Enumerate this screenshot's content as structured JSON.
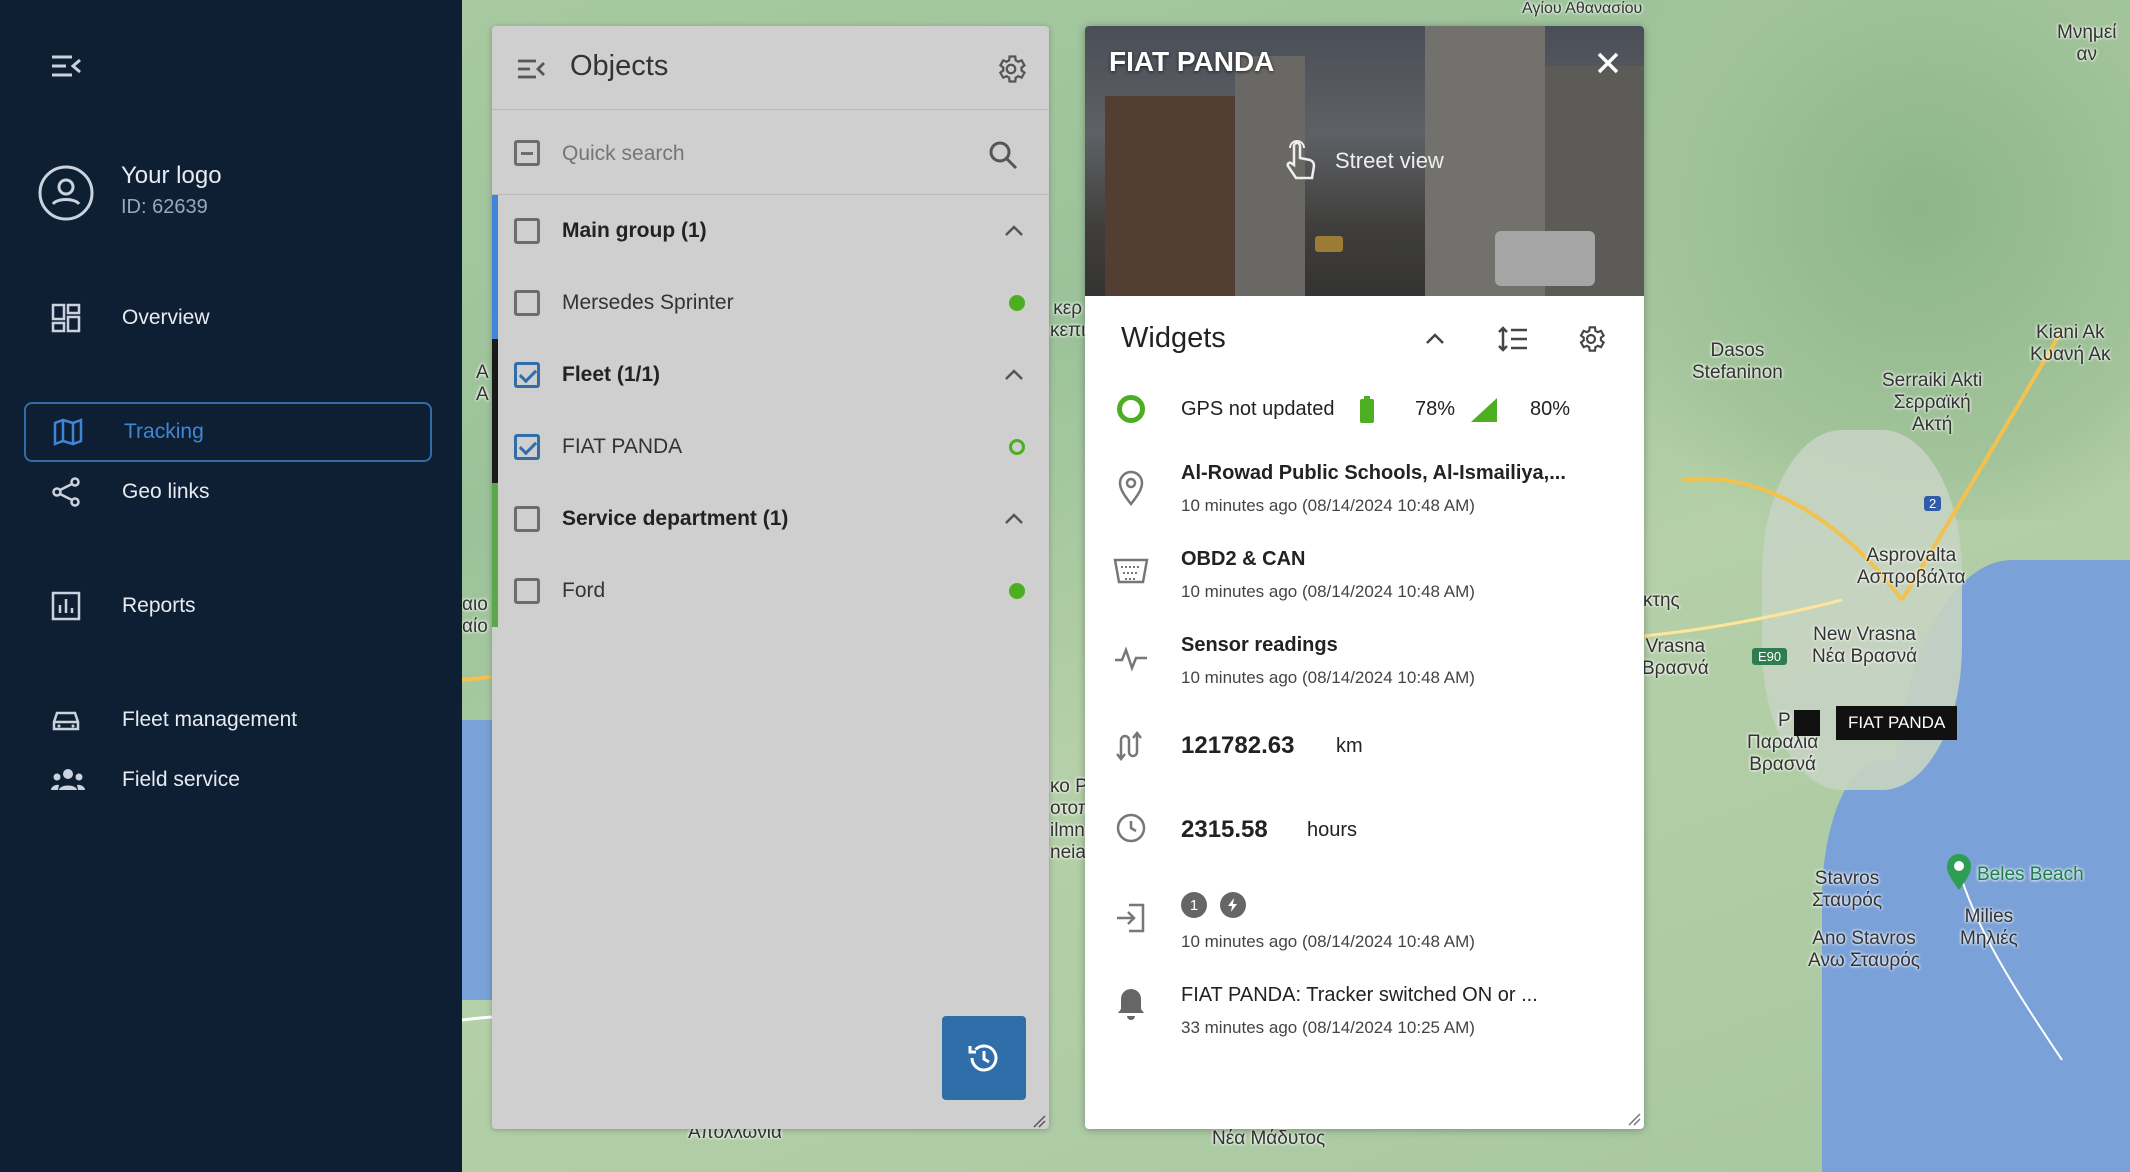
{
  "sidebar": {
    "account_name": "Your logo",
    "account_id": "ID: 62639",
    "items": [
      {
        "label": "Overview",
        "icon": "dashboard-icon"
      },
      {
        "label": "Tracking",
        "icon": "map-icon",
        "active": true
      },
      {
        "label": "Geo links",
        "icon": "share-icon"
      },
      {
        "label": "Reports",
        "icon": "chart-icon"
      },
      {
        "label": "Fleet management",
        "icon": "car-icon"
      },
      {
        "label": "Field service",
        "icon": "people-icon"
      }
    ]
  },
  "objects": {
    "title": "Objects",
    "search_placeholder": "Quick search",
    "rows": [
      {
        "label": "Main group (1)",
        "type": "group",
        "checked": false
      },
      {
        "label": "Mersedes Sprinter",
        "type": "item",
        "checked": false,
        "status": "online"
      },
      {
        "label": "Fleet (1/1)",
        "type": "group",
        "checked": true
      },
      {
        "label": "FIAT PANDA",
        "type": "item",
        "checked": true,
        "status": "idle"
      },
      {
        "label": "Service department (1)",
        "type": "group",
        "checked": false
      },
      {
        "label": "Ford",
        "type": "item",
        "checked": false,
        "status": "online"
      }
    ]
  },
  "detail": {
    "title": "FIAT PANDA",
    "street_view_label": "Street view",
    "widgets_title": "Widgets",
    "gps_status": "GPS not updated",
    "battery": "78%",
    "signal": "80%",
    "address": "Al-Rowad Public Schools, Al-Ismailiya,...",
    "address_time": "10 minutes ago (08/14/2024 10:48 AM)",
    "obd_title": "OBD2 & CAN",
    "obd_time": "10 minutes ago (08/14/2024 10:48 AM)",
    "sensor_title": "Sensor readings",
    "sensor_time": "10 minutes ago (08/14/2024 10:48 AM)",
    "odometer_value": "121782.63",
    "odometer_unit": "km",
    "engine_hours_value": "2315.58",
    "engine_hours_unit": "hours",
    "input_badge_1": "1",
    "inputs_time": "10 minutes ago (08/14/2024 10:48 AM)",
    "event_title": "FIAT PANDA: Tracker switched ON or ...",
    "event_time": "33 minutes ago (08/14/2024 10:25 AM)"
  },
  "map": {
    "labels": {
      "agiou": "Αγίου Αθανασίου",
      "mnimeia": "Μνημεί\nαν",
      "dasos": "Dasos\nStefaninon",
      "kiani": "Kiani Ak\nΚυανή Ακ",
      "serraiki": "Serraiki Akti\nΣερραϊκή\nΑκτή",
      "asprovalta": "Asprovalta\nΑσπροβάλτα",
      "new_vrasna": "New Vrasna\nΝέα Βρασνά",
      "vrasna": "Vrasna\nΒρασνά",
      "paralia": "Παραλία\nΒρασνά",
      "stavros": "Stavros\nΣταυρός",
      "ano_stavros": "Ano Stavros\nΑνω Σταυρός",
      "milies": "Milies\nΜηλιές",
      "beles": "Beles Beach",
      "apollonia": "Απολλωνία",
      "nea_madytos": "Νέα Μάδυτος",
      "road_e90": "E90",
      "road_2": "2",
      "aktis": "άκτης",
      "vehicle_tag": "FIAT PANDA",
      "frag_keper": "κερ\nκεπι",
      "frag_a": "Α\nΑ",
      "frag_aio": "αιο\nαίο",
      "frag_ko": "κο Ρ\nοτοπ\nilmn\nneia",
      "frag_pl": "P"
    }
  },
  "colors": {
    "sidebar_bg": "#0f1f33",
    "accent": "#2f6ea9",
    "status_green": "#4caf22"
  }
}
